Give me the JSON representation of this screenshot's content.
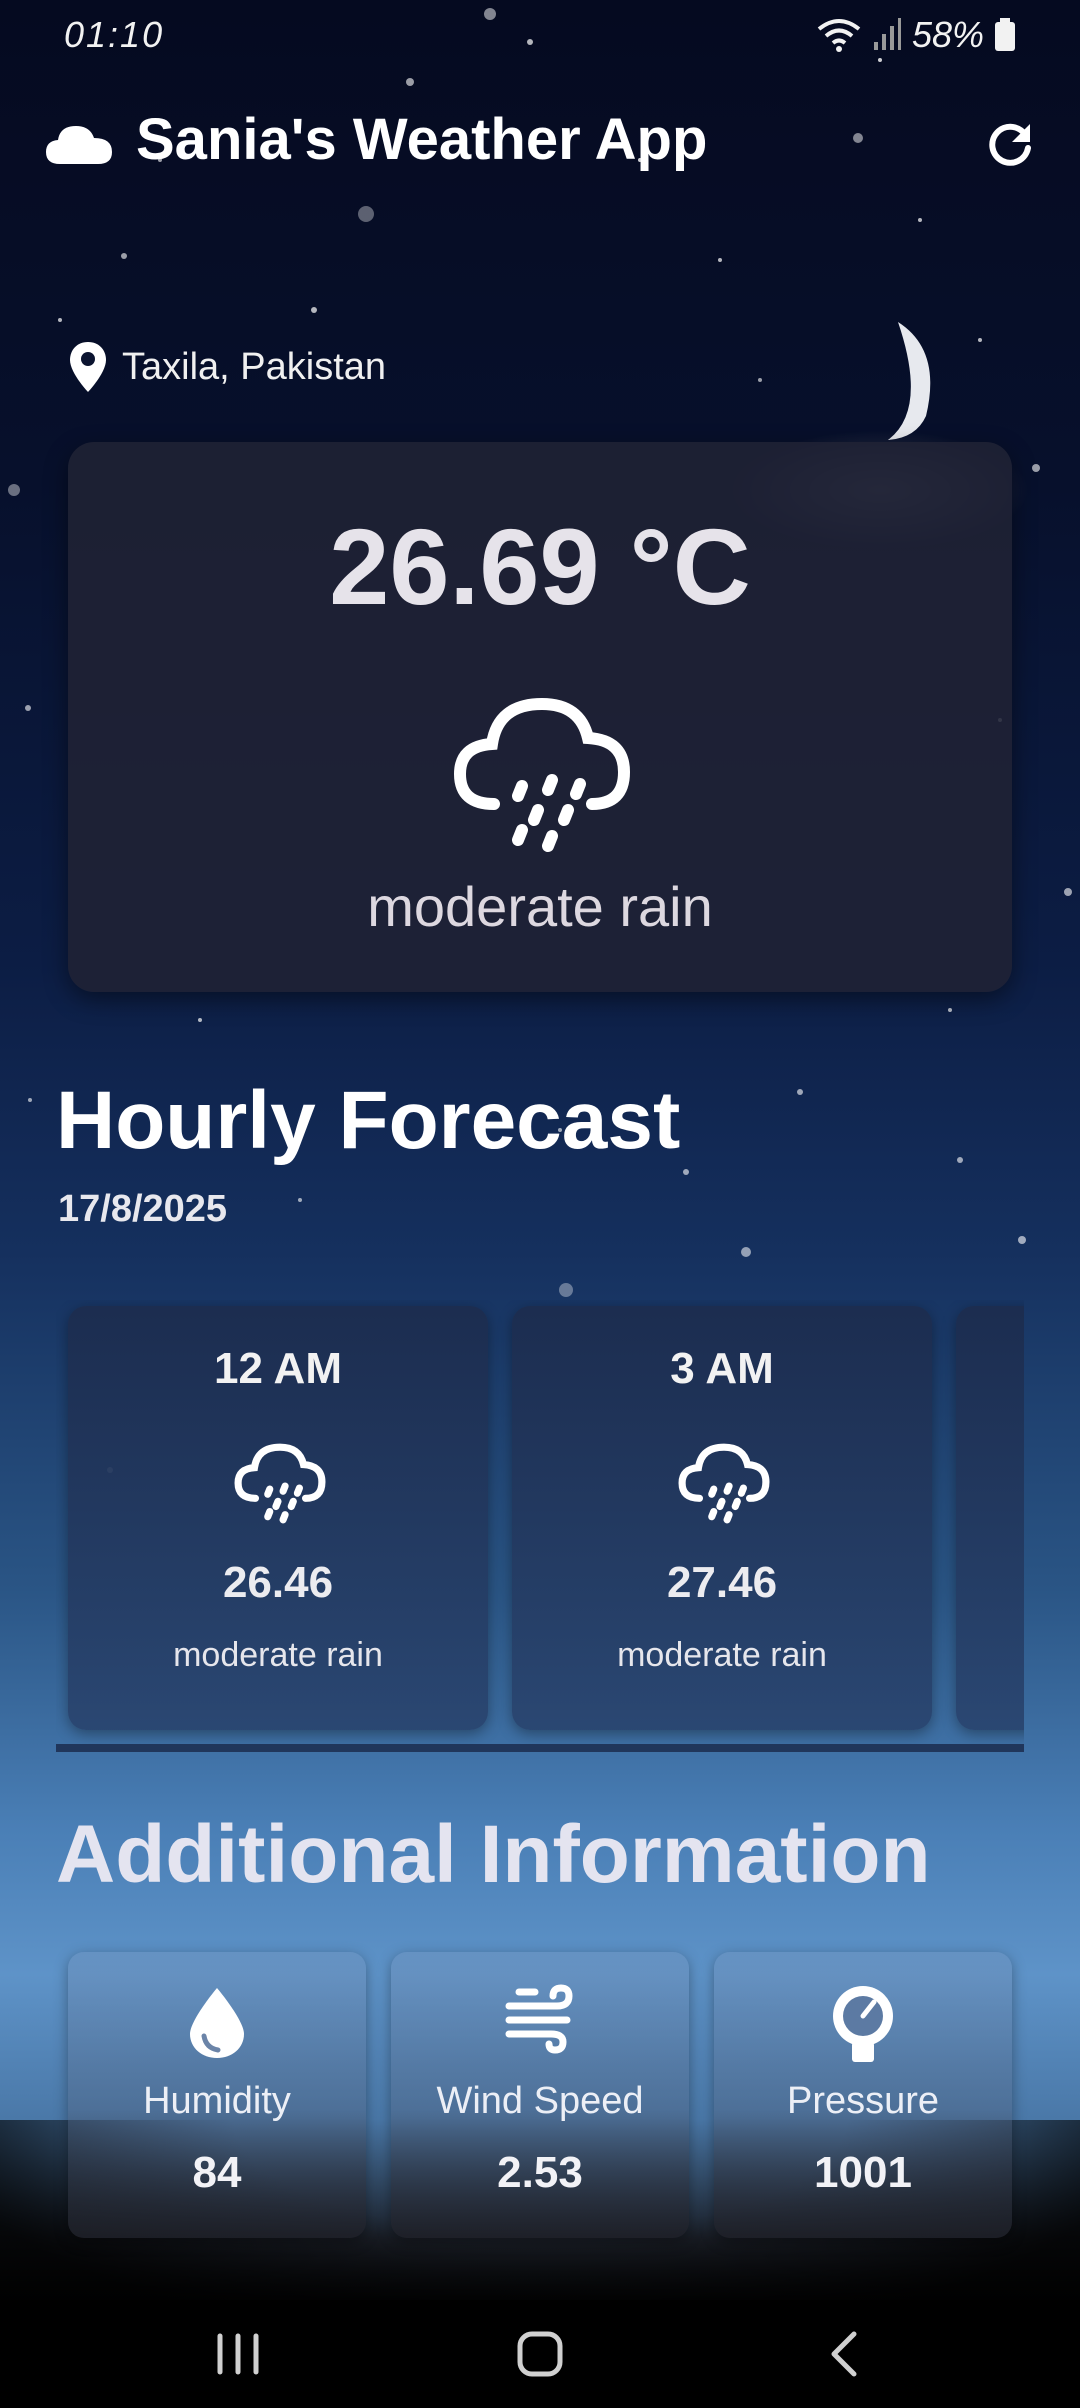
{
  "status_bar": {
    "time": "01:10",
    "battery": "58%"
  },
  "app_bar": {
    "title": "Sania's Weather App",
    "cloud_icon": "cloud-icon",
    "refresh_icon": "refresh-icon"
  },
  "location": {
    "text": "Taxila, Pakistan",
    "icon": "location-pin-icon"
  },
  "current": {
    "temperature": "26.69 °C",
    "condition": "moderate rain",
    "icon": "rain-cloud-icon"
  },
  "hourly": {
    "title": "Hourly Forecast",
    "date": "17/8/2025",
    "items": [
      {
        "time": "12 AM",
        "temp": "26.46",
        "condition": "moderate rain",
        "icon": "rain-cloud-icon"
      },
      {
        "time": "3 AM",
        "temp": "27.46",
        "condition": "moderate rain",
        "icon": "rain-cloud-icon"
      }
    ]
  },
  "additional": {
    "title": "Additional Information",
    "items": [
      {
        "label": "Humidity",
        "value": "84",
        "icon": "water-drop-icon"
      },
      {
        "label": "Wind Speed",
        "value": "2.53",
        "icon": "wind-icon"
      },
      {
        "label": "Pressure",
        "value": "1001",
        "icon": "gauge-icon"
      }
    ]
  },
  "colors": {
    "card_dark": "#202234",
    "sky_top": "#050a20",
    "sky_bottom": "#5e93c8"
  }
}
